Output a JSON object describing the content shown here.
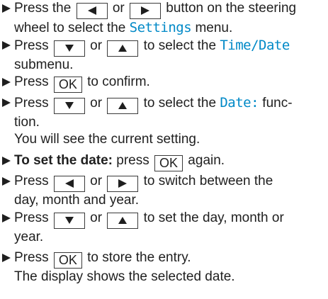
{
  "steps": [
    {
      "pre": "Press the ",
      "mid": " or ",
      "post": " button on the steering",
      "line2": "wheel to select the ",
      "menu": "Settings",
      "line2_end": " menu."
    },
    {
      "pre": "Press ",
      "mid": " or ",
      "post": " to select the ",
      "menu": "Time/Date",
      "line2": "submenu."
    },
    {
      "pre": "Press ",
      "key": "OK",
      "post": " to confirm."
    },
    {
      "pre": "Press ",
      "mid": " or ",
      "post": " to select the ",
      "menu": "Date:",
      "post2": " func-",
      "line2": "tion.",
      "note": "You will see the current setting."
    },
    {
      "bold": "To set the date:",
      "pre": " press ",
      "key": "OK",
      "post": " again."
    },
    {
      "pre": "Press ",
      "mid": " or ",
      "post": " to switch between the",
      "line2": "day, month and year."
    },
    {
      "pre": "Press ",
      "mid": " or ",
      "post": " to set the day, month or",
      "line2": "year."
    },
    {
      "pre": "Press ",
      "key": "OK",
      "post": " to store the entry.",
      "note": "The display shows the selected date."
    }
  ],
  "icons": {
    "bullet": "triangle-right-icon",
    "left": "triangle-left-icon",
    "right": "triangle-right-icon",
    "down": "triangle-down-icon",
    "up": "triangle-up-icon"
  },
  "colors": {
    "display_text": "#0089c7",
    "body_text": "#1f1f1f"
  }
}
